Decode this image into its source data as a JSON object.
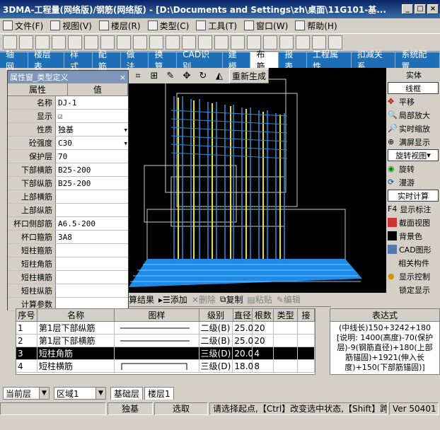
{
  "window": {
    "title": "3DMA-工程量(网络版)/钢筋(网络版) - [D:\\Documents and Settings\\zh\\桌面\\11G101-基..."
  },
  "menu": [
    "文件(F)",
    "视图(V)",
    "楼层(R)",
    "类型(C)",
    "工具(T)",
    "窗口(W)",
    "帮助(H)"
  ],
  "tabs": [
    "轴网",
    "楼层表",
    "样式",
    "配筋",
    "做法",
    "换算",
    "CAD识别",
    "建模",
    "布筋",
    "报表",
    "工程属性",
    "扣减关系",
    "系统配置"
  ],
  "active_tab": "布筋",
  "prop": {
    "title": "属性窗_类型定义",
    "col1": "属性",
    "col2": "值",
    "rows": [
      {
        "k": "名称",
        "v": "DJ-1"
      },
      {
        "k": "显示",
        "v": "☑"
      },
      {
        "k": "性质",
        "v": "独基"
      },
      {
        "k": "砼强度",
        "v": "C30"
      },
      {
        "k": "保护层",
        "v": "70"
      },
      {
        "k": "下部横筋",
        "v": "B25-200"
      },
      {
        "k": "下部纵筋",
        "v": "B25-200"
      },
      {
        "k": "上部横筋",
        "v": ""
      },
      {
        "k": "上部纵筋",
        "v": ""
      },
      {
        "k": "杯口侧部筋",
        "v": "A6.5-200"
      },
      {
        "k": "杯口箍筋",
        "v": "3A8"
      },
      {
        "k": "短柱箍筋",
        "v": ""
      },
      {
        "k": "短柱角筋",
        "v": ""
      },
      {
        "k": "短柱横筋",
        "v": ""
      },
      {
        "k": "短柱纵筋",
        "v": ""
      },
      {
        "k": "计算参数",
        "v": ""
      }
    ]
  },
  "viewtools": {
    "regen": "重新生成"
  },
  "right": {
    "solid": "实体",
    "wire": "线框",
    "pan": "平移",
    "localzoom": "局部放大",
    "rtzoom": "实时缩放",
    "fullscreen": "满屏显示",
    "rotview": "旋转视图",
    "rotate": "旋转",
    "roam": "漫游",
    "realtime": "实时计算",
    "f4": "F4",
    "showmark": "显示标注",
    "section": "截面视图",
    "bg": "背景色",
    "cad": "CAD图形",
    "related": "相关构件",
    "showctrl": "显示控制",
    "lock": "锁定显示"
  },
  "bottom": {
    "result": "算结果",
    "add": "添加",
    "del": "删除",
    "copy": "复制",
    "paste": "粘贴",
    "edit": "编辑"
  },
  "grid": {
    "headers": [
      "序号",
      "名称",
      "图样",
      "级别",
      "直径",
      "根数",
      "类型",
      "接"
    ],
    "rows": [
      [
        "1",
        "第1层下部纵筋",
        "",
        "二级(B)",
        "25.0",
        "20",
        "",
        ""
      ],
      [
        "2",
        "第1层下部横筋",
        "",
        "二级(B)",
        "25.0",
        "20",
        "",
        ""
      ],
      [
        "3",
        "短柱角筋",
        "",
        "三级(D)",
        "20.0",
        "4",
        "",
        ""
      ],
      [
        "4",
        "短柱横筋",
        "",
        "三级(D)",
        "18.0",
        "8",
        "",
        ""
      ]
    ]
  },
  "expr": {
    "title": "表达式",
    "text": "(中线长)150+3242+180 [说明: 1400(高度)-70(保护层)-9(钢筋直径)+180(上部筋锚固)+1921(伸入长度)+150(下部筋锚固)]"
  },
  "layer": {
    "current": "当前层",
    "area": "区域1",
    "tab1": "基础层",
    "tab2": "楼层1"
  },
  "status": {
    "s1": "独基",
    "s2": "选取",
    "s3": "请选择起点,【Ctrl】改变选中状态,【Shift】跨类",
    "s4": "Ver 50401"
  }
}
